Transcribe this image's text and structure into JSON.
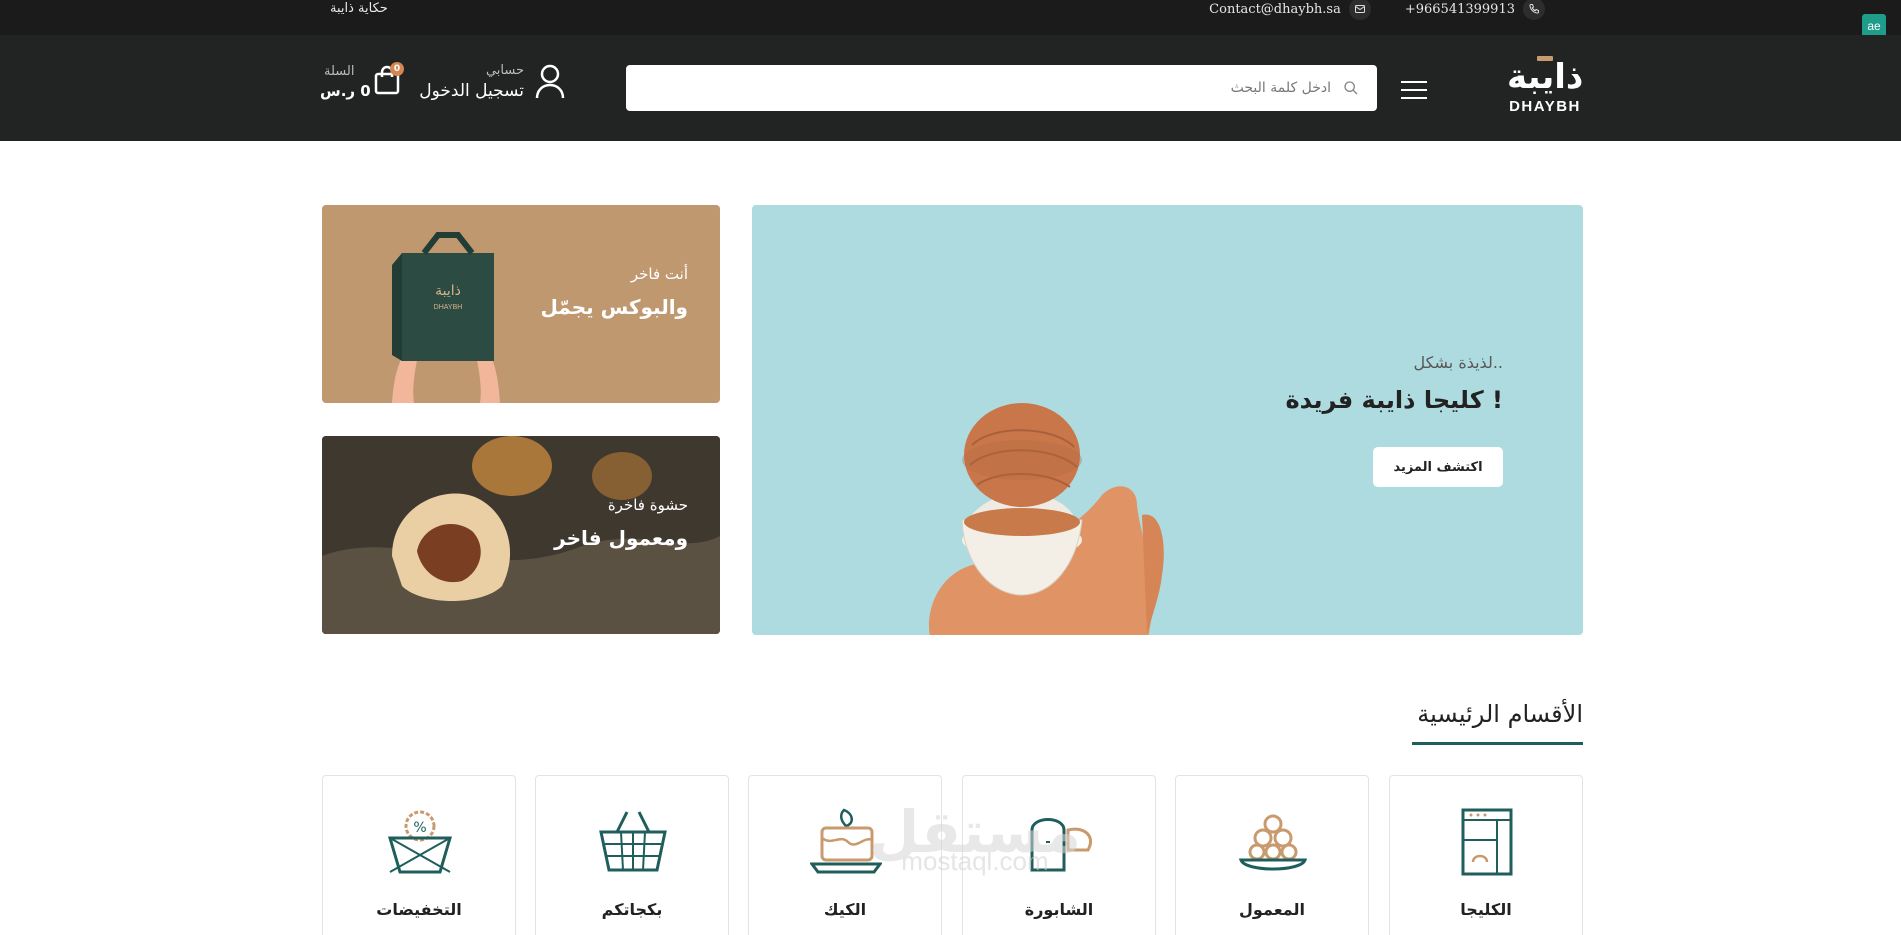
{
  "topbar": {
    "story_link": "حكاية ذايبة",
    "email": "Contact@dhaybh.sa",
    "phone": "+966541399913",
    "email_icon": "mail-icon",
    "phone_icon": "phone-icon",
    "ext_badge": "ae"
  },
  "header": {
    "logo_ar": "ذايبة",
    "logo_en": "DHAYBH",
    "search_placeholder": "ادخل كلمة البحث",
    "account_small": "حسابي",
    "account_big": "تسجيل الدخول",
    "cart_small": "السلة",
    "cart_total": "0 ر.س",
    "cart_count": "0"
  },
  "hero": {
    "subtitle": "لذيذة بشكل..",
    "title": "كليجا ذايبة فريدة !",
    "button": "اكتشف المزيد"
  },
  "promos": [
    {
      "subtitle": "أنت فاخر",
      "title": "والبوكس يجمّل"
    },
    {
      "subtitle": "حشوة فاخرة",
      "title": "ومعمول فاخر"
    }
  ],
  "categories_section": {
    "title": "الأقسام الرئيسية",
    "items": [
      {
        "label": "الكليجا",
        "icon": "kleija-icon"
      },
      {
        "label": "المعمول",
        "icon": "maamoul-icon"
      },
      {
        "label": "الشابورة",
        "icon": "bread-icon"
      },
      {
        "label": "الكيك",
        "icon": "cake-icon"
      },
      {
        "label": "بكجاتكم",
        "icon": "basket-icon"
      },
      {
        "label": "التخفيضات",
        "icon": "discount-icon"
      }
    ]
  },
  "watermark": {
    "ar": "مستقل",
    "en": "mostaql.com"
  },
  "colors": {
    "topbar_bg": "#1b1b1b",
    "header_bg": "#222323",
    "hero_bg": "#aedbe0",
    "accent_teal": "#1f5e5b",
    "accent_tan": "#c99a6e"
  }
}
